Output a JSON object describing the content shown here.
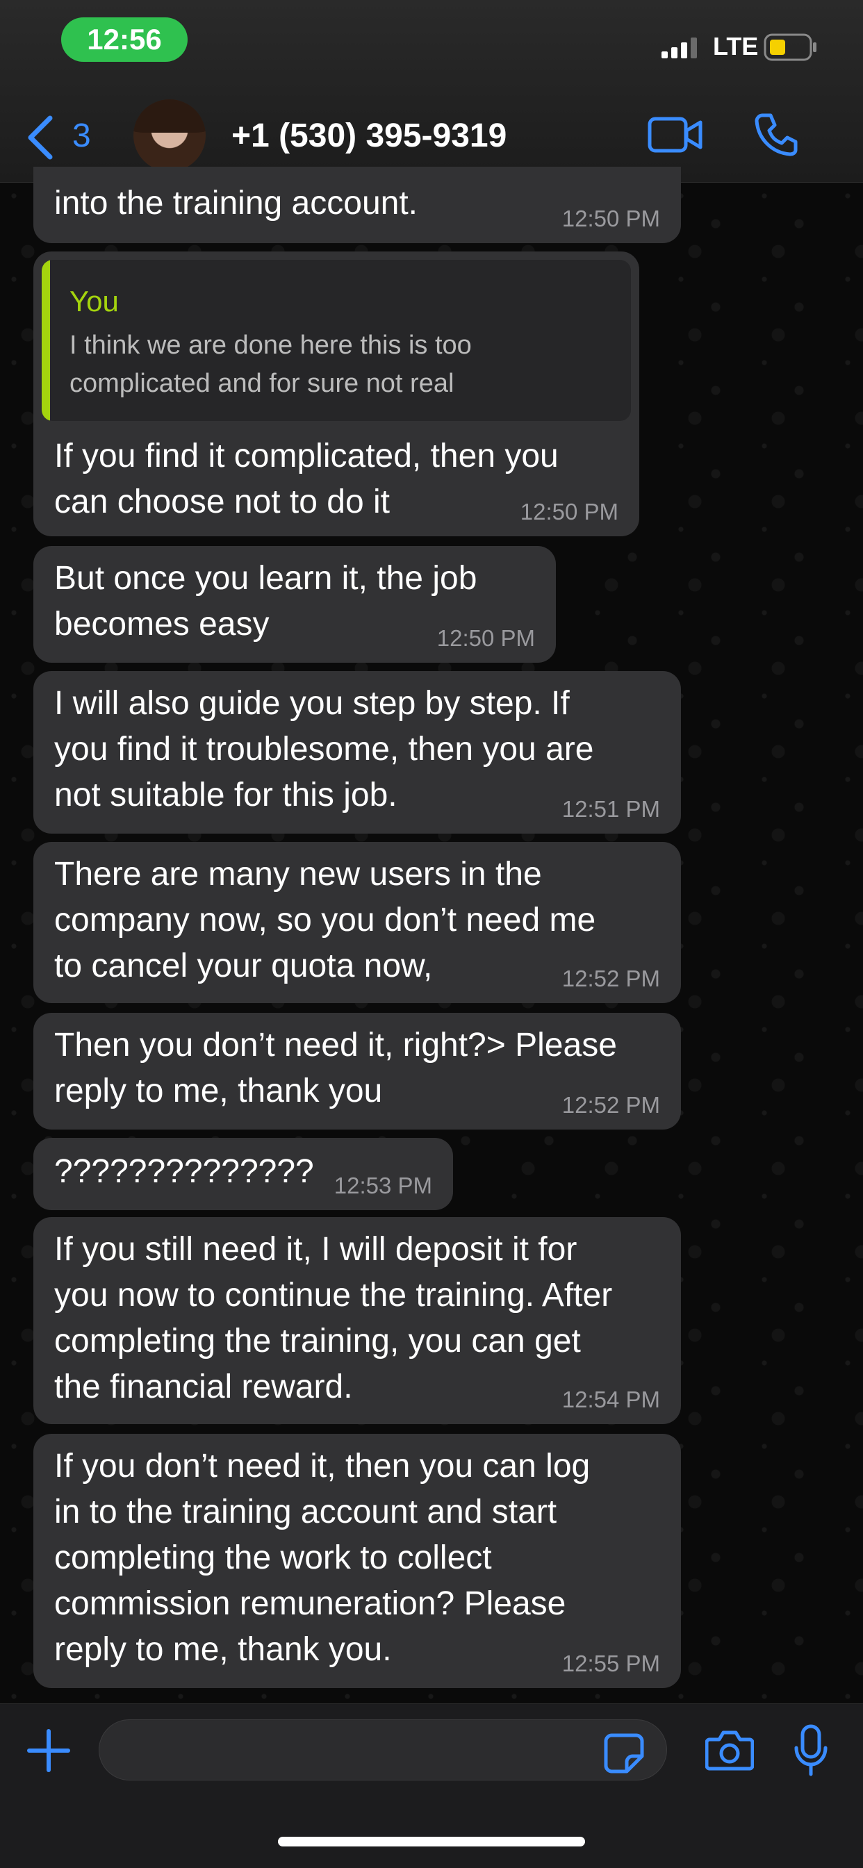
{
  "status_bar": {
    "time": "12:56",
    "network": "LTE",
    "colors": {
      "time_pill": "#2fc14f",
      "battery_fill": "#f5d000"
    }
  },
  "header": {
    "back_count": "3",
    "contact_name": "+1 (530) 395-9319",
    "icons": [
      "chevron-left-icon",
      "video-camera-icon",
      "phone-icon"
    ],
    "accent_color": "#3a8cff"
  },
  "messages": [
    {
      "text": "into the training account.",
      "time": "12:50 PM"
    },
    {
      "reply_to": {
        "author": "You",
        "text": "I think we are done here this is too\ncomplicated and for sure not real"
      },
      "text": "If you find it complicated, then you\ncan choose not to do it",
      "time": "12:50 PM"
    },
    {
      "text": "But once you learn it, the job\nbecomes easy",
      "time": "12:50 PM"
    },
    {
      "text": "I will also guide you step by step. If\nyou find it troublesome, then you are\nnot suitable for this job.",
      "time": "12:51 PM"
    },
    {
      "text": "There are many new users in the\ncompany now, so you don’t need me\nto cancel your quota now,",
      "time": "12:52 PM"
    },
    {
      "text": "Then you don’t need it, right?> Please\nreply to me, thank you",
      "time": "12:52 PM"
    },
    {
      "text": "??????????????",
      "time": "12:53 PM"
    },
    {
      "text": "If you still need it, I will deposit it for\nyou now to continue the training. After\ncompleting the training, you can get\nthe financial reward.",
      "time": "12:54 PM"
    },
    {
      "text": "If you don’t need it, then you can log\nin to the training account and start\ncompleting the work to collect\ncommission remuneration? Please\nreply to me, thank you.",
      "time": "12:55 PM"
    }
  ],
  "composer": {
    "icons": [
      "plus-icon",
      "sticker-icon",
      "camera-icon",
      "microphone-icon"
    ]
  }
}
